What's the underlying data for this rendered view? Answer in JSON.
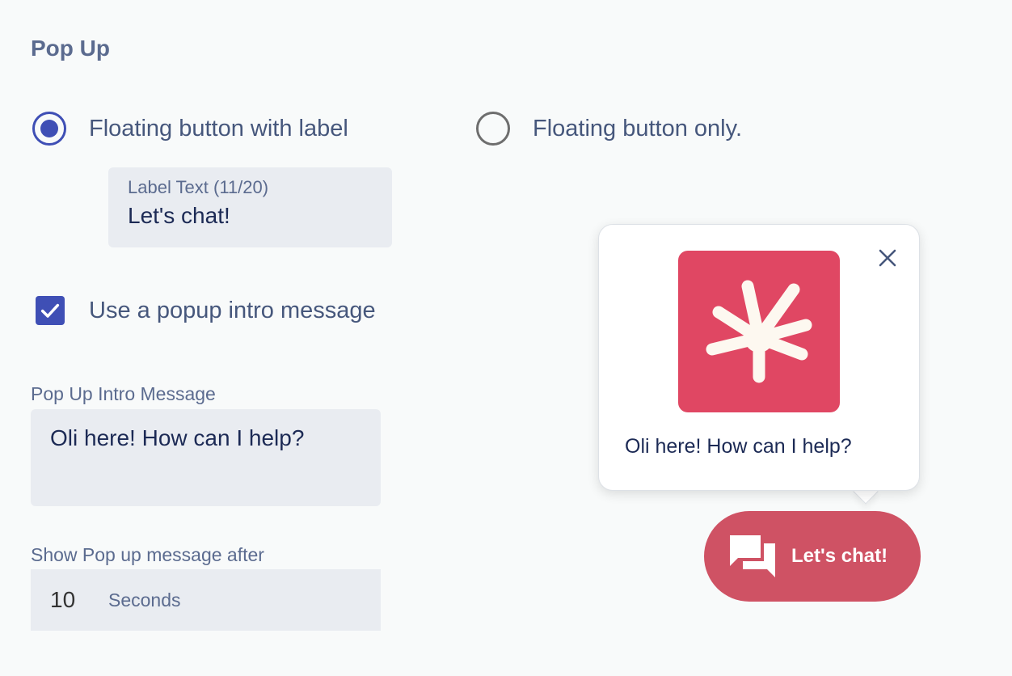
{
  "section": {
    "title": "Pop Up"
  },
  "display_mode": {
    "options": [
      {
        "label": "Floating button with label",
        "selected": true
      },
      {
        "label": "Floating button only.",
        "selected": false
      }
    ]
  },
  "label_text": {
    "caption": "Label Text (11/20)",
    "value": "Let's chat!"
  },
  "intro_toggle": {
    "label": "Use a popup intro message",
    "checked": true
  },
  "intro_message": {
    "caption": "Pop Up Intro Message",
    "value": "Oli here! How can I help?"
  },
  "delay": {
    "caption": "Show Pop up message after",
    "value": "10",
    "unit": "Seconds"
  },
  "preview": {
    "message": "Oli here! How can I help?",
    "button_label": "Let's chat!",
    "logo_icon": "asterisk-logo-icon",
    "close_icon": "close-icon",
    "chat_icon": "chat-bubbles-icon"
  },
  "colors": {
    "accent": "#3f4fb5",
    "brand": "#e04763",
    "chat_button": "#cf5264"
  }
}
